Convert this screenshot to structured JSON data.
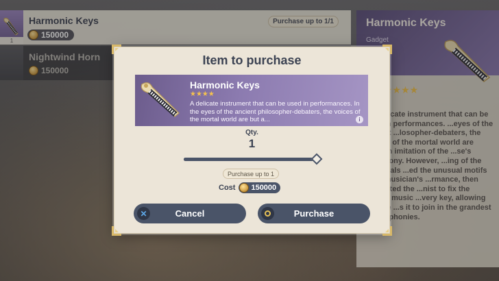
{
  "list": {
    "items": [
      {
        "name": "Harmonic Keys",
        "price": "150000",
        "limit": "Purchase up to 1/1",
        "badge": "1"
      },
      {
        "name": "Nightwind Horn",
        "price": "150000"
      }
    ]
  },
  "detail": {
    "title": "Harmonic Keys",
    "type": "Gadget",
    "stars": "★★★★",
    "description": "...a delicate instrument that can be used in performances. ...eyes of the ancient ...losopher-debaters, the ...oices of the mortal world are ...rough imitation of the ...se's symphony. However, ...ing of the Immortals ...ed the unusual motifs ...the musician's ...rmance, then instructed the ...nist to fix the eternal music ...very key, allowing anyone ...s it to join in the grandest of symphonies."
  },
  "dialog": {
    "title": "Item to purchase",
    "item": {
      "name": "Harmonic Keys",
      "stars": "★★★★",
      "description": "A delicate instrument that can be used in performances. In the eyes of the ancient philosopher-debaters, the voices of the mortal world are but a..."
    },
    "qty_label": "Qty.",
    "qty_value": "1",
    "slider": {
      "value": 1,
      "max": 1
    },
    "purchase_limit": "Purchase up to 1",
    "cost_label": "Cost",
    "cost_value": "150000",
    "cancel_label": "Cancel",
    "purchase_label": "Purchase"
  },
  "colors": {
    "dialog_bg": "#ece5d8",
    "button_bg": "#4a5468",
    "card_purple": "#8c7bb0",
    "star_gold": "#f5c24e"
  }
}
